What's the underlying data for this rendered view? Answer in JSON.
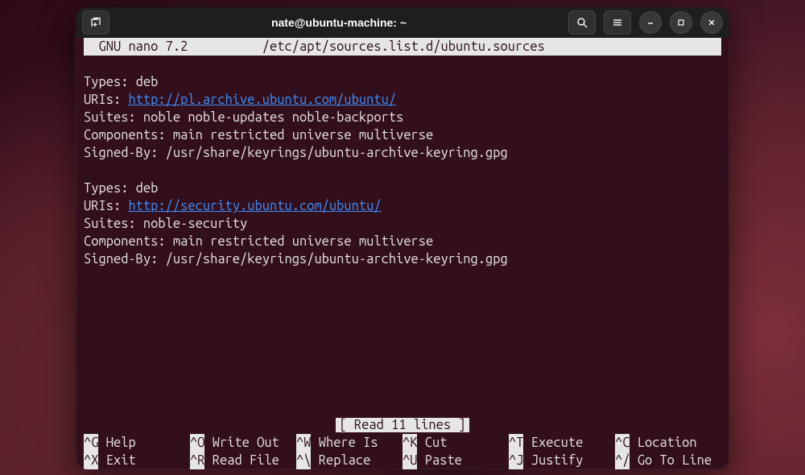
{
  "window": {
    "title": "nate@ubuntu-machine: ~"
  },
  "nano": {
    "app": "  GNU nano 7.2",
    "file": "/etc/apt/sources.list.d/ubuntu.sources",
    "status": "[ Read 11 lines ]"
  },
  "content": {
    "block1": {
      "types": "Types: deb",
      "uris_label": "URIs: ",
      "uris_value": "http://pl.archive.ubuntu.com/ubuntu/",
      "suites": "Suites: noble noble-updates noble-backports",
      "components": "Components: main restricted universe multiverse",
      "signed": "Signed-By: /usr/share/keyrings/ubuntu-archive-keyring.gpg"
    },
    "block2": {
      "types": "Types: deb",
      "uris_label": "URIs: ",
      "uris_value": "http://security.ubuntu.com/ubuntu/",
      "suites": "Suites: noble-security",
      "components": "Components: main restricted universe multiverse",
      "signed": "Signed-By: /usr/share/keyrings/ubuntu-archive-keyring.gpg"
    }
  },
  "shortcuts": [
    {
      "key": "^G",
      "label": " Help"
    },
    {
      "key": "^O",
      "label": " Write Out"
    },
    {
      "key": "^W",
      "label": " Where Is"
    },
    {
      "key": "^K",
      "label": " Cut"
    },
    {
      "key": "^T",
      "label": " Execute"
    },
    {
      "key": "^C",
      "label": " Location"
    },
    {
      "key": "^X",
      "label": " Exit"
    },
    {
      "key": "^R",
      "label": " Read File"
    },
    {
      "key": "^\\",
      "label": " Replace"
    },
    {
      "key": "^U",
      "label": " Paste"
    },
    {
      "key": "^J",
      "label": " Justify"
    },
    {
      "key": "^/",
      "label": " Go To Line"
    }
  ]
}
